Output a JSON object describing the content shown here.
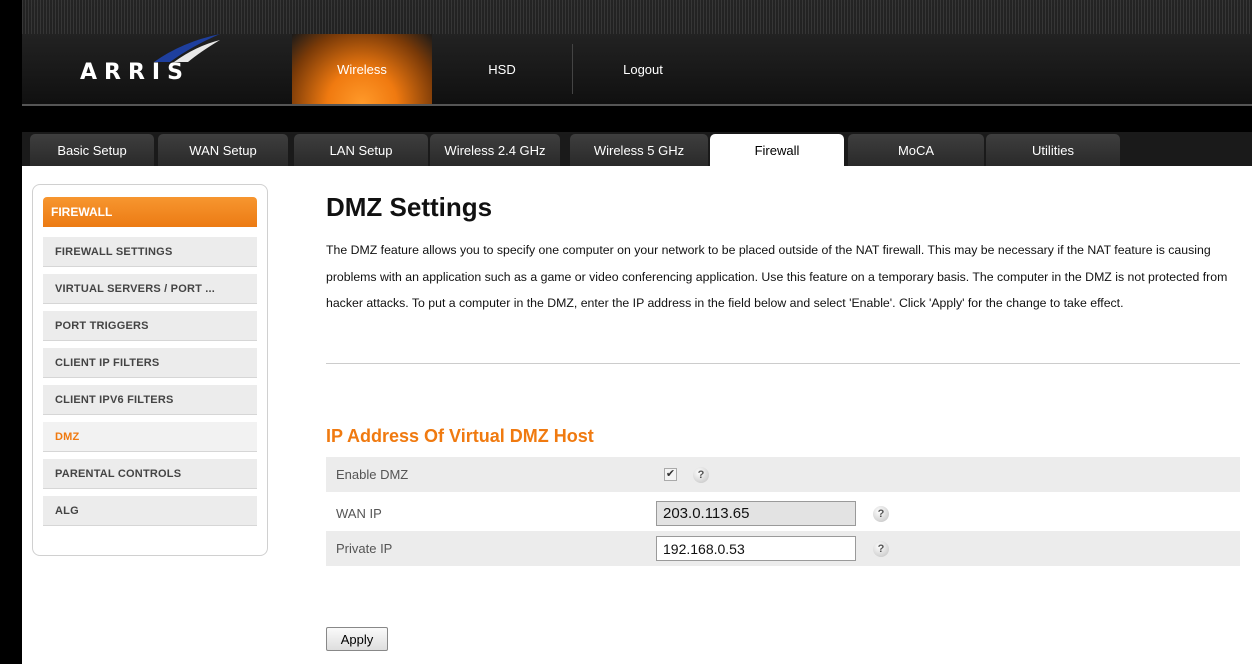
{
  "brand": {
    "logo_text": "ARRIS"
  },
  "topnav": {
    "items": [
      "Wireless",
      "HSD",
      "Logout"
    ],
    "active": "Wireless"
  },
  "tabs": [
    "Basic Setup",
    "WAN Setup",
    "LAN Setup",
    "Wireless 2.4 GHz",
    "Wireless 5 GHz",
    "Firewall",
    "MoCA",
    "Utilities"
  ],
  "active_tab": "Firewall",
  "sidebar": {
    "header": "FIREWALL",
    "items": [
      "FIREWALL SETTINGS",
      "VIRTUAL SERVERS / PORT ...",
      "PORT TRIGGERS",
      "CLIENT IP FILTERS",
      "CLIENT IPV6 FILTERS",
      "DMZ",
      "PARENTAL CONTROLS",
      "ALG"
    ],
    "active": "DMZ"
  },
  "main": {
    "title": "DMZ Settings",
    "description": "The DMZ feature allows you to specify one computer on your network to be placed outside of the NAT firewall. This may be necessary if the NAT feature is causing problems with an application such as a game or video conferencing application. Use this feature on a temporary basis. The computer in the DMZ is not protected from hacker attacks. To put a computer in the DMZ, enter the IP address in the field below and select 'Enable'. Click 'Apply' for the change to take effect.",
    "section_title": "IP Address Of Virtual DMZ Host",
    "enable_dmz_label": "Enable DMZ",
    "enable_dmz_checked": true,
    "wan_ip_label": "WAN IP",
    "wan_ip_value": "203.0.113.65",
    "private_ip_label": "Private IP",
    "private_ip_value": "192.168.0.53",
    "help_glyph": "?",
    "apply_label": "Apply"
  },
  "colors": {
    "accent": "#f07a10",
    "header_bg": "#1b1b1b",
    "row_shade": "#ececec"
  }
}
